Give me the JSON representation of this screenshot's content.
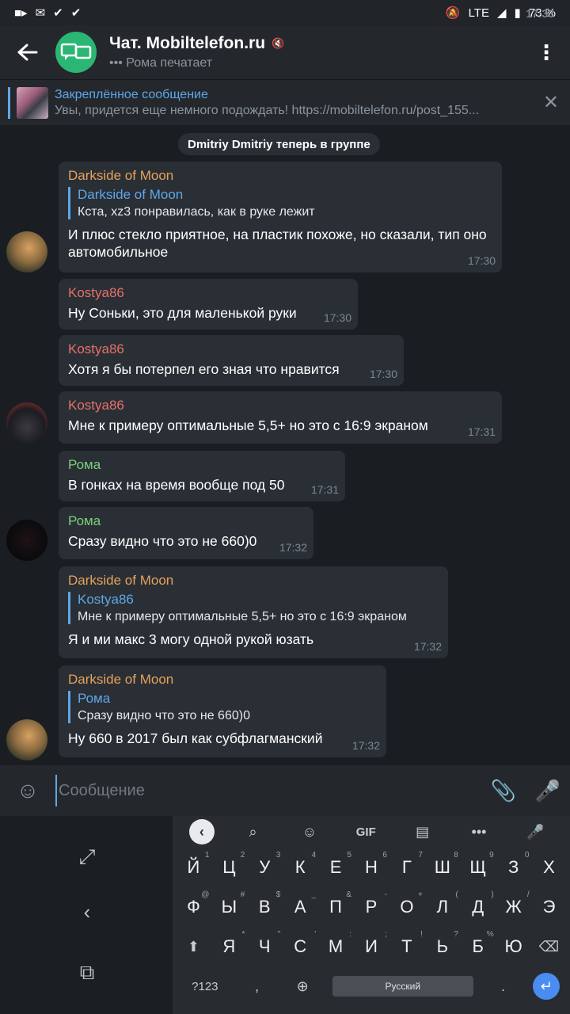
{
  "status": {
    "time": "17:33",
    "network": "LTE",
    "battery": "73 %"
  },
  "header": {
    "title": "Чат. Mobiltelefon.ru",
    "subtitle": "••• Рома печатает"
  },
  "pinned": {
    "title": "Закреплённое сообщение",
    "text": "Увы, придется еще немного подождать! https://mobiltelefon.ru/post_155..."
  },
  "service_message": "Dmitriy Dmitriy теперь в группе",
  "messages": [
    {
      "sender": "Darkside of Moon",
      "reply_name": "Darkside of Moon",
      "reply_text": "Кста, xz3 понравилась, как в руке лежит",
      "text": "И плюс стекло приятное, на пластик похоже, но сказали, тип оно автомобильное",
      "time": "17:30"
    },
    {
      "sender": "Kostya86",
      "text": "Ну Соньки, это для маленькой руки",
      "time": "17:30"
    },
    {
      "sender": "Kostya86",
      "text": "Хотя я бы потерпел его зная что нравится",
      "time": "17:30"
    },
    {
      "sender": "Kostya86",
      "text": "Мне к примеру оптимальные 5,5+ но это с 16:9 экраном",
      "time": "17:31"
    },
    {
      "sender": "Рома",
      "text": "В гонках на время вообще под 50",
      "time": "17:31"
    },
    {
      "sender": "Рома",
      "text": "Сразу видно что это не 660)0",
      "time": "17:32"
    },
    {
      "sender": "Darkside of Moon",
      "reply_name": "Kostya86",
      "reply_text": "Мне к примеру оптимальные 5,5+ но это с 16:9 экраном",
      "text": "Я и ми макс 3 могу одной рукой юзать",
      "time": "17:32"
    },
    {
      "sender": "Darkside of Moon",
      "reply_name": "Рома",
      "reply_text": "Сразу видно что это не 660)0",
      "text": "Ну 660 в 2017 был как субфлагманский",
      "time": "17:32"
    }
  ],
  "colors": {
    "darkside": "#e6a25a",
    "kostya": "#e8706a",
    "roma": "#7ccf7c",
    "accent": "#5fa7e8"
  },
  "input": {
    "placeholder": "Сообщение"
  },
  "keyboard": {
    "row1": [
      "Й",
      "Ц",
      "У",
      "К",
      "Е",
      "Н",
      "Г",
      "Ш",
      "Щ",
      "З",
      "Х"
    ],
    "row1_hints": [
      "1",
      "2",
      "3",
      "4",
      "5",
      "6",
      "7",
      "8",
      "9",
      "0",
      ""
    ],
    "row2": [
      "Ф",
      "Ы",
      "В",
      "А",
      "П",
      "Р",
      "О",
      "Л",
      "Д",
      "Ж",
      "Э"
    ],
    "row2_hints": [
      "@",
      "#",
      "$",
      "_",
      "&",
      "-",
      "+",
      "(",
      ")",
      "/",
      ""
    ],
    "row3": [
      "Я",
      "Ч",
      "С",
      "М",
      "И",
      "Т",
      "Ь",
      "Б",
      "Ю"
    ],
    "row3_hints": [
      "*",
      "\"",
      "'",
      ":",
      ";",
      "!",
      "?",
      "%",
      ""
    ],
    "num_key": "?123",
    "comma": ",",
    "space_label": "Русский",
    "period": ".",
    "toolbar_gif": "GIF"
  }
}
